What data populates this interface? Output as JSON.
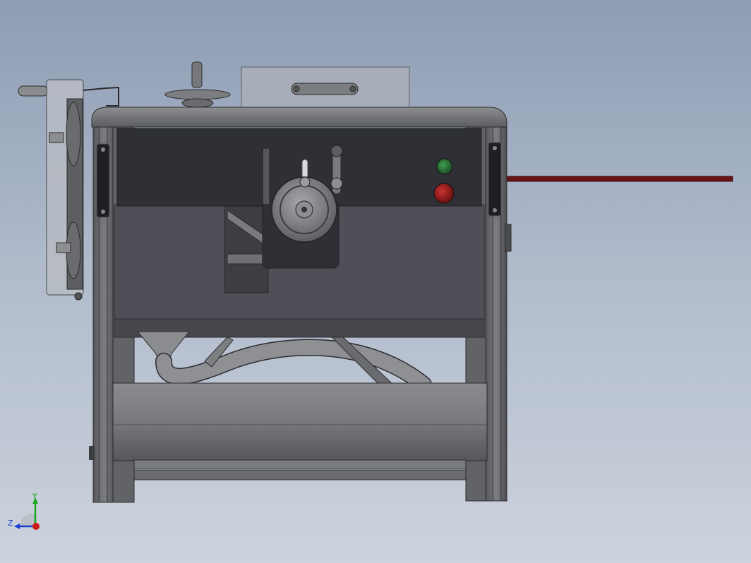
{
  "viewport": {
    "background_top": "#8e9db4",
    "background_bottom": "#cdd3dd"
  },
  "model": {
    "frame_color": "#6e6f72",
    "panel_color": "#2f3035",
    "body_color": "#4f5057",
    "bar_color": "#6a1414",
    "button_green": "#2f7a3c",
    "button_red": "#8a1e1e"
  },
  "triad": {
    "y_label": "Y",
    "z_label": "Z",
    "y_color": "#1aa61a",
    "z_color": "#1a3fd0",
    "x_color": "#d01a1a"
  }
}
